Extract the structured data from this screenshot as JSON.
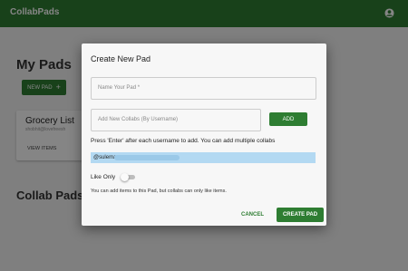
{
  "appbar": {
    "title": "CollabPads",
    "account_icon": "account-circle-icon",
    "color": "#2e7d32"
  },
  "page": {
    "heading": "My Pads",
    "new_pad_label": "NEW PAD",
    "new_pad_icon": "+",
    "card": {
      "title": "Grocery List",
      "subtitle": "shobhit@lovefreesh",
      "view_items_label": "VIEW ITEMS"
    },
    "collab_heading": "Collab Pads"
  },
  "dialog": {
    "title": "Create New Pad",
    "pad_name_placeholder": "Name Your Pad *",
    "collab_placeholder": "Add New Collabs (By Username)",
    "add_label": "ADD",
    "hint": "Press 'Enter' after each username to add. You can add multiple collabs",
    "chip_username": "@suleman",
    "like_only_label": "Like Only",
    "like_only_enabled": false,
    "like_only_note": "You can add items to this Pad, but collabs can only like items.",
    "cancel_label": "CANCEL",
    "create_label": "CREATE PAD"
  }
}
